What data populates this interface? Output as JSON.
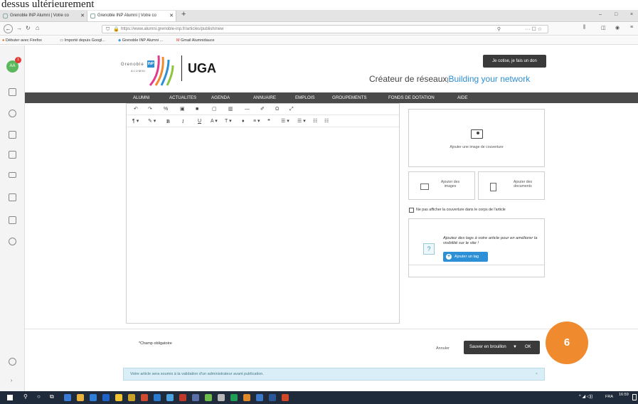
{
  "caption": "dessus ultérieurement",
  "browser": {
    "tabs": [
      {
        "label": "Grenoble INP Alumni | Votre co"
      },
      {
        "label": "Grenoble INP Alumni | Votre co"
      }
    ],
    "new_tab": "+",
    "url": "https://www.alumni.grenoble-inp.fr/articles/publish/new",
    "window_controls": [
      "–",
      "□",
      "×"
    ],
    "bookmarks": [
      "Débuter avec Firefox",
      "Importé depuis Googl...",
      "Grenoble INP Alumni ...",
      "Gmail Alumnidauce"
    ]
  },
  "sidebar": {
    "avatar_initials": "AA",
    "avatar_badge": "1"
  },
  "header": {
    "logo_text_top": "Grenoble",
    "logo_text_inp": "INP",
    "logo_text_alumni": "ALUMNI",
    "partner_logo": "UGA",
    "donate_button": "Je cotise, je fais un don",
    "tagline_main": "Créateur de réseaux",
    "tagline_sep": "|",
    "tagline_en": "Building your network"
  },
  "nav": {
    "items": [
      "ALUMNI",
      "ACTUALITES",
      "AGENDA",
      "ANNUAIRE",
      "EMPLOIS",
      "GROUPEMENTS",
      "FONDS DE DOTATION",
      "AIDE"
    ]
  },
  "editor": {
    "toolbar_row1": [
      "↶",
      "↷",
      "%",
      "▣",
      "■",
      "▢",
      "▥",
      "—",
      "✐",
      "Ω",
      "⤢"
    ],
    "toolbar_row2": [
      "¶ ▾",
      "✎ ▾",
      "B",
      "I",
      "U",
      "A ▾",
      "T ▾",
      "♦",
      "≡ ▾",
      "❝",
      "☰ ▾",
      "☰ ▾",
      "☷",
      "☷"
    ]
  },
  "right_panel": {
    "cover_label": "Ajouter une image de couverture",
    "add_images_label": "Ajouter des images",
    "add_documents_label": "Ajouter des documents",
    "hide_cover_label": "Ne pas afficher la couverture dans le corps de l'article",
    "tags_text": "Ajoutez des tags à votre article pour en améliorer la visibilité sur le site !",
    "add_tag_button": "Ajouter un tag"
  },
  "footer": {
    "required_note": "*Champ obligatoire",
    "cancel_label": "Annuler",
    "save_draft_label": "Sauver en brouillon",
    "ok_label": "OK",
    "notice": "Votre article sera soumis à la validation d'un administrateur avant publication.",
    "notice_close": "×"
  },
  "step_badge": "6",
  "taskbar": {
    "lang": "FRA",
    "time": "16:59"
  },
  "colors": {
    "nav_bg": "#4a4a4a",
    "accent_blue": "#2d8fd5",
    "step_orange": "#ef8a2f",
    "notice_bg": "#d9eef6"
  }
}
